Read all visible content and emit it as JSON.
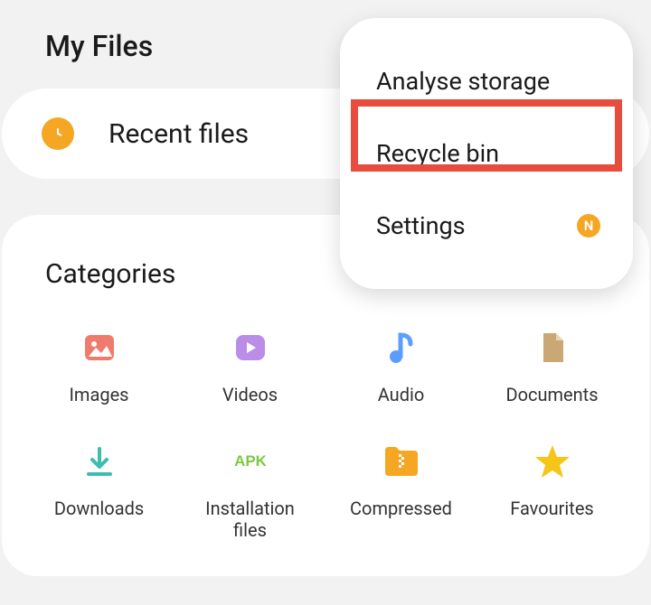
{
  "header": {
    "title": "My Files"
  },
  "recent": {
    "label": "Recent files"
  },
  "categories": {
    "title": "Categories",
    "items": [
      {
        "label": "Images"
      },
      {
        "label": "Videos"
      },
      {
        "label": "Audio"
      },
      {
        "label": "Documents"
      },
      {
        "label": "Downloads"
      },
      {
        "label": "Installation\nfiles"
      },
      {
        "label": "Compressed"
      },
      {
        "label": "Favourites"
      }
    ]
  },
  "popup": {
    "items": [
      {
        "label": "Analyse storage"
      },
      {
        "label": "Recycle bin"
      },
      {
        "label": "Settings",
        "badge": "N"
      }
    ]
  }
}
